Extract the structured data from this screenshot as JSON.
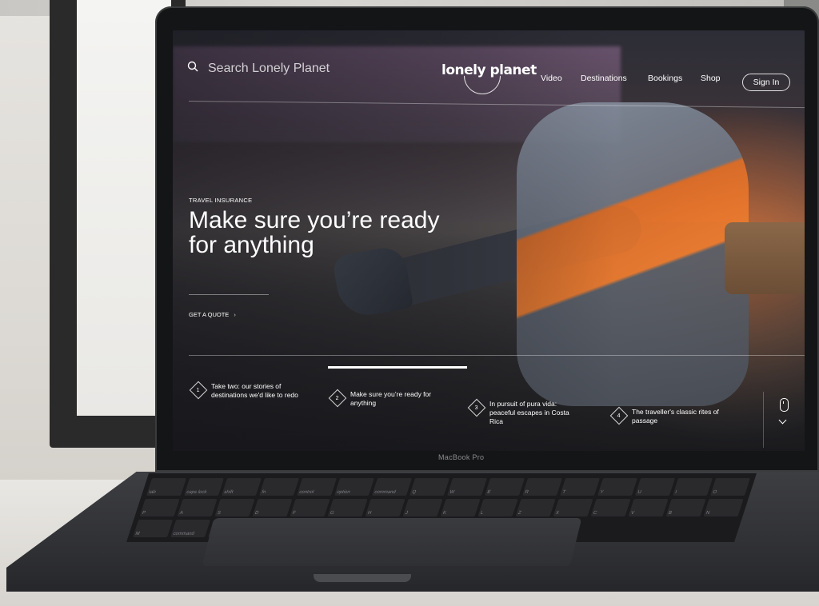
{
  "colors": {
    "accent_orange": "#f07d2f",
    "overlay_text": "#ffffff",
    "bezel": "#141516"
  },
  "device": {
    "bezel_label": "MacBook Pro"
  },
  "header": {
    "search_placeholder": "Search Lonely Planet",
    "search_icon": "search-icon",
    "logo_text": "lonely planet",
    "nav": [
      "Video",
      "Destinations",
      "Bookings",
      "Shop"
    ],
    "sign_in_label": "Sign In"
  },
  "hero": {
    "eyebrow": "TRAVEL INSURANCE",
    "headline_line1": "Make sure you’re ready",
    "headline_line2": "for anything",
    "cta_label": "GET A QUOTE",
    "cta_icon": "chevron-right-icon",
    "progress_active_index": 2
  },
  "stories": [
    {
      "number": "1",
      "title": "Take two: our stories of destinations we'd like to redo"
    },
    {
      "number": "2",
      "title": "Make sure you’re ready for anything"
    },
    {
      "number": "3",
      "title": "In pursuit of pura vida: peaceful escapes in Costa Rica"
    },
    {
      "number": "4",
      "title": "The traveller's classic rites of passage"
    }
  ],
  "scroll_cue": {
    "icons": [
      "mouse-icon",
      "chevron-down-icon"
    ]
  },
  "keyboard": {
    "labels": [
      "tab",
      "caps lock",
      "shift",
      "fn",
      "control",
      "option",
      "command",
      "Q",
      "W",
      "E",
      "R",
      "T",
      "Y",
      "U",
      "I",
      "O",
      "P",
      "A",
      "S",
      "D",
      "F",
      "G",
      "H",
      "J",
      "K",
      "L",
      "Z",
      "X",
      "C",
      "V",
      "B",
      "N",
      "M",
      "command",
      "option",
      "delete",
      "return",
      "shift"
    ]
  }
}
